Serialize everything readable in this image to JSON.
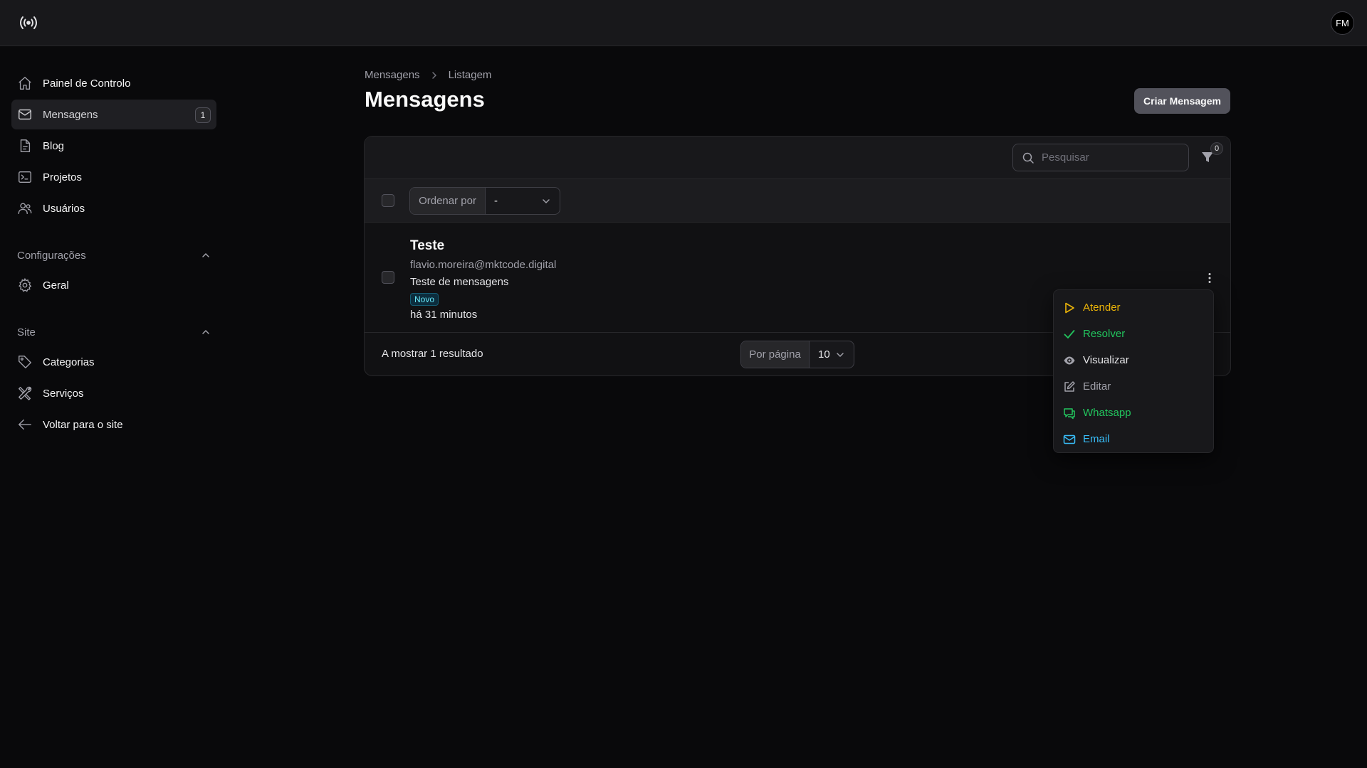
{
  "header": {
    "avatar_initials": "FM",
    "logo_icon": "broadcast-logo-icon"
  },
  "sidebar": {
    "items": [
      {
        "label": "Painel de Controlo",
        "icon": "home-icon"
      },
      {
        "label": "Mensagens",
        "icon": "mail-icon",
        "badge": "1",
        "active": true
      },
      {
        "label": "Blog",
        "icon": "document-icon"
      },
      {
        "label": "Projetos",
        "icon": "terminal-window-icon"
      },
      {
        "label": "Usuários",
        "icon": "users-icon"
      }
    ],
    "groups": [
      {
        "label": "Configurações",
        "items": [
          {
            "label": "Geral",
            "icon": "gear-icon"
          }
        ]
      },
      {
        "label": "Site",
        "items": [
          {
            "label": "Categorias",
            "icon": "tag-icon"
          },
          {
            "label": "Serviços",
            "icon": "tools-icon"
          },
          {
            "label": "Voltar para o site",
            "icon": "arrow-left-icon"
          }
        ]
      }
    ]
  },
  "breadcrumb": {
    "items": [
      "Mensagens",
      "Listagem"
    ]
  },
  "page": {
    "title": "Mensagens",
    "create_label": "Criar Mensagem"
  },
  "table": {
    "search_placeholder": "Pesquisar",
    "filter_count": "0",
    "sort_label": "Ordenar por",
    "sort_value": "-",
    "rows": [
      {
        "title": "Teste",
        "email": "flavio.moreira@mktcode.digital",
        "subject": "Teste de mensagens",
        "status": "Novo",
        "time": "há 31 minutos"
      }
    ],
    "footer_text": "A mostrar 1 resultado",
    "per_page_label": "Por página",
    "per_page_value": "10"
  },
  "menu": {
    "items": [
      {
        "label": "Atender",
        "icon": "play-icon",
        "color": "#eab308"
      },
      {
        "label": "Resolver",
        "icon": "check-icon",
        "color": "#22c55e"
      },
      {
        "label": "Visualizar",
        "icon": "eye-icon",
        "color": "#e4e4e7"
      },
      {
        "label": "Editar",
        "icon": "edit-icon",
        "color": "#a1a1aa"
      },
      {
        "label": "Whatsapp",
        "icon": "chat-icon",
        "color": "#22c55e"
      },
      {
        "label": "Email",
        "icon": "mail-icon",
        "color": "#38bdf8"
      }
    ]
  }
}
